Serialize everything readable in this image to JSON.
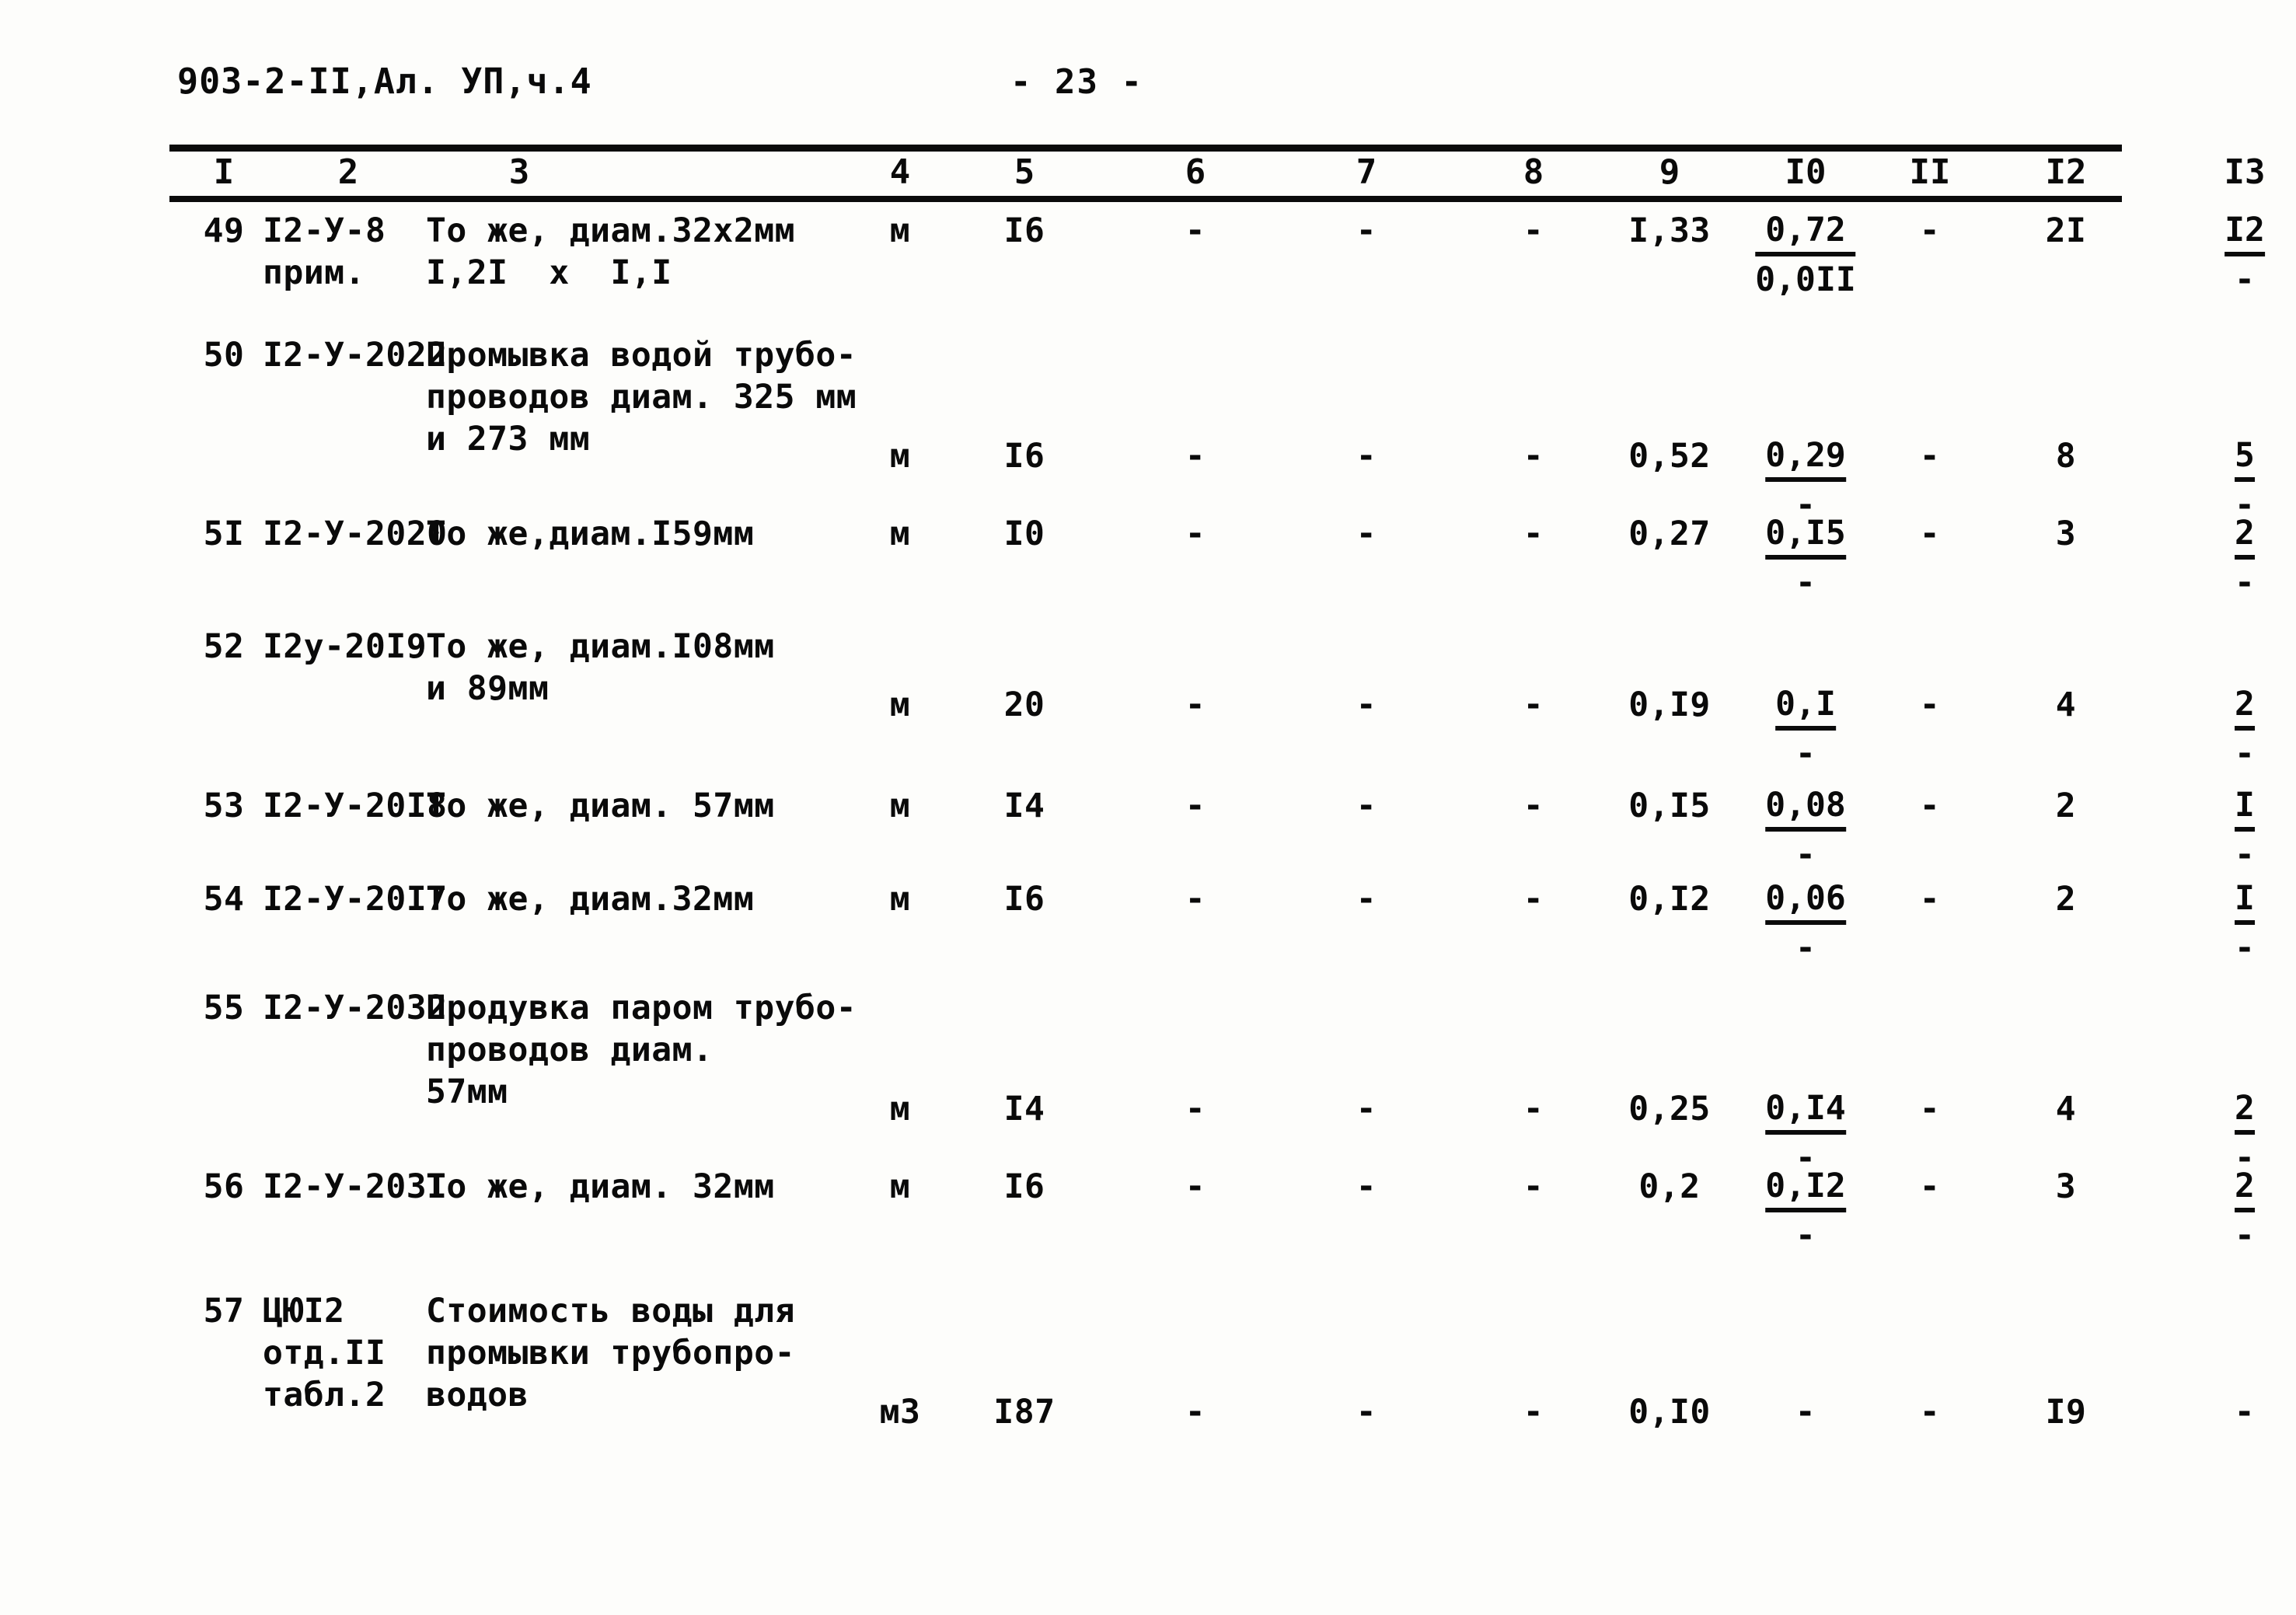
{
  "header": {
    "doc_code": "903-2-II,Ал. УП,ч.4",
    "page_number": "- 23 -"
  },
  "table": {
    "column_headers": [
      "I",
      "2",
      "3",
      "4",
      "5",
      "6",
      "7",
      "8",
      "9",
      "I0",
      "II",
      "I2",
      "I3"
    ],
    "rows": [
      {
        "num": "49",
        "code": "I2-У-8\nприм.",
        "name": "То же, диам.32х2мм\nI,2I  х  I,I",
        "unit": "м",
        "qty": "I6",
        "c6": "-",
        "c7": "-",
        "c8": "-",
        "c9": "I,33",
        "c10_num": "0,72",
        "c10_den": "0,0II",
        "c11": "-",
        "c12": "2I",
        "c13_num": "I2",
        "c13_den": "-"
      },
      {
        "num": "50",
        "code": "I2-У-2022",
        "name": "Промывка водой трубо-\nпроводов диам. 325 мм\nи 273 мм",
        "unit": "м",
        "qty": "I6",
        "c6": "-",
        "c7": "-",
        "c8": "-",
        "c9": "0,52",
        "c10_num": "0,29",
        "c10_den": "-",
        "c11": "-",
        "c12": "8",
        "c13_num": "5",
        "c13_den": "-"
      },
      {
        "num": "5I",
        "code": "I2-У-2020",
        "name": "То же,диам.I59мм",
        "unit": "м",
        "qty": "I0",
        "c6": "-",
        "c7": "-",
        "c8": "-",
        "c9": "0,27",
        "c10_num": "0,I5",
        "c10_den": "-",
        "c11": "-",
        "c12": "3",
        "c13_num": "2",
        "c13_den": "-"
      },
      {
        "num": "52",
        "code": "I2у-20I9",
        "name": "То же, диам.I08мм\nи 89мм",
        "unit": "м",
        "qty": "20",
        "c6": "-",
        "c7": "-",
        "c8": "-",
        "c9": "0,I9",
        "c10_num": "0,I",
        "c10_den": "-",
        "c11": "-",
        "c12": "4",
        "c13_num": "2",
        "c13_den": "-"
      },
      {
        "num": "53",
        "code": "I2-У-20I8",
        "name": "То же, диам. 57мм",
        "unit": "м",
        "qty": "I4",
        "c6": "-",
        "c7": "-",
        "c8": "-",
        "c9": "0,I5",
        "c10_num": "0,08",
        "c10_den": "-",
        "c11": "-",
        "c12": "2",
        "c13_num": "I",
        "c13_den": "-"
      },
      {
        "num": "54",
        "code": "I2-У-20I7",
        "name": "То же, диам.32мм",
        "unit": "м",
        "qty": "I6",
        "c6": "-",
        "c7": "-",
        "c8": "-",
        "c9": "0,I2",
        "c10_num": "0,06",
        "c10_den": "-",
        "c11": "-",
        "c12": "2",
        "c13_num": "I",
        "c13_den": "-"
      },
      {
        "num": "55",
        "code": "I2-У-2032",
        "name": "Продувка паром трубо-\nпроводов диам.\n57мм",
        "unit": "м",
        "qty": "I4",
        "c6": "-",
        "c7": "-",
        "c8": "-",
        "c9": "0,25",
        "c10_num": "0,I4",
        "c10_den": "-",
        "c11": "-",
        "c12": "4",
        "c13_num": "2",
        "c13_den": "-"
      },
      {
        "num": "56",
        "code": "I2-У-203I",
        "name": "То же, диам. 32мм",
        "unit": "м",
        "qty": "I6",
        "c6": "-",
        "c7": "-",
        "c8": "-",
        "c9": "0,2",
        "c10_num": "0,I2",
        "c10_den": "-",
        "c11": "-",
        "c12": "3",
        "c13_num": "2",
        "c13_den": "-"
      },
      {
        "num": "57",
        "code": "ЦЮI2\nотд.II\nтабл.2",
        "name": "Стоимость воды для\nпромывки трубопро-\nводов",
        "unit": "м3",
        "qty": "I87",
        "c6": "-",
        "c7": "-",
        "c8": "-",
        "c9": "0,I0",
        "c10_num": "-",
        "c10_den": "",
        "c11": "-",
        "c12": "I9",
        "c13_num": "-",
        "c13_den": ""
      }
    ]
  }
}
